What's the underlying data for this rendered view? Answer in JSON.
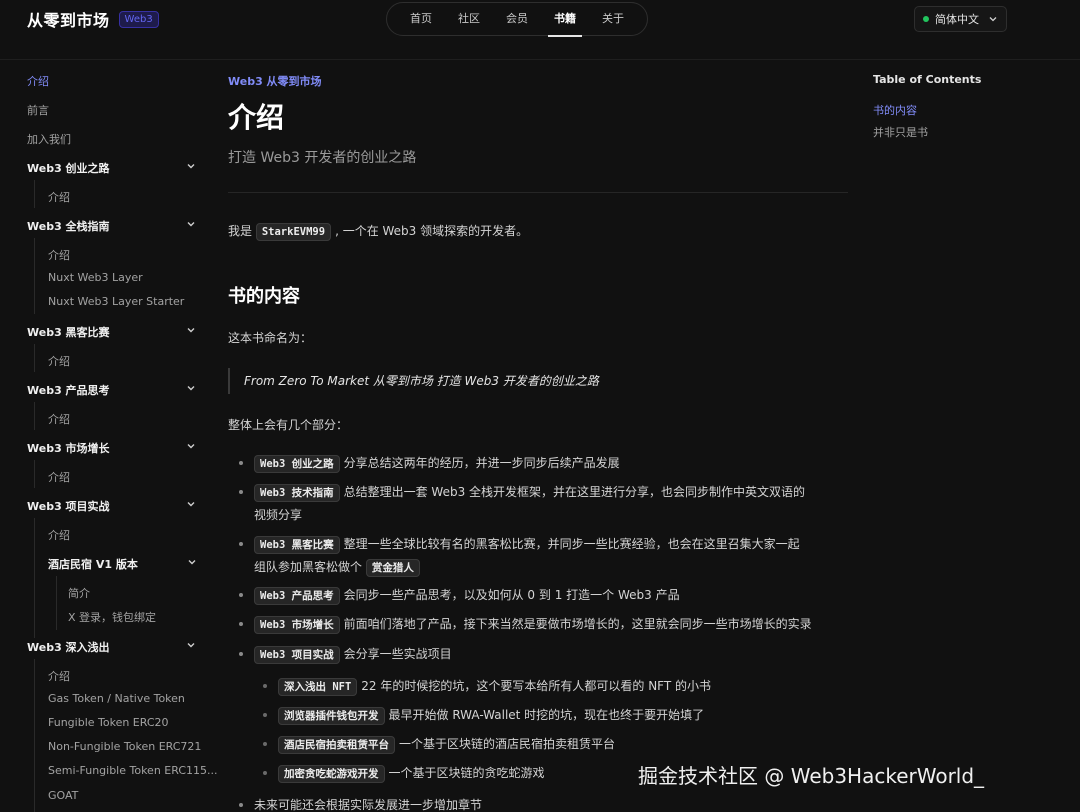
{
  "brand": {
    "title": "从零到市场",
    "badge": "Web3"
  },
  "nav": {
    "items": [
      "首页",
      "社区",
      "会员",
      "书籍",
      "关于"
    ],
    "active": "书籍"
  },
  "language": {
    "label": "简体中文",
    "status_color": "#22c55e"
  },
  "sidebar": {
    "top_items": [
      "介绍",
      "前言",
      "加入我们"
    ],
    "active_item": "介绍",
    "sections": [
      {
        "title": "Web3 创业之路",
        "items": [
          "介绍"
        ]
      },
      {
        "title": "Web3 全栈指南",
        "items": [
          "介绍",
          "Nuxt Web3 Layer",
          "Nuxt Web3 Layer Starter"
        ]
      },
      {
        "title": "Web3 黑客比赛",
        "items": [
          "介绍"
        ]
      },
      {
        "title": "Web3 产品思考",
        "items": [
          "介绍"
        ]
      },
      {
        "title": "Web3 市场增长",
        "items": [
          "介绍"
        ]
      },
      {
        "title": "Web3 项目实战",
        "items": [
          "介绍"
        ],
        "subsection": {
          "title": "酒店民宿 V1 版本",
          "items": [
            "简介",
            "X 登录，钱包绑定"
          ]
        }
      },
      {
        "title": "Web3 深入浅出",
        "items": [
          "介绍",
          "Gas Token / Native Token",
          "Fungible Token ERC20",
          "Non-Fungible Token ERC721",
          "Semi-Fungible Token ERC115...",
          "GOAT"
        ]
      }
    ]
  },
  "main": {
    "eyebrow": "Web3 从零到市场",
    "title": "介绍",
    "subtitle": "打造 Web3 开发者的创业之路",
    "intro": {
      "before": "我是",
      "code": "StarkEVM99",
      "after": ", 一个在 Web3 领域探索的开发者。"
    },
    "section_heading": "书的内容",
    "book_name_label": "这本书命名为：",
    "quote": "From Zero To Market 从零到市场 打造 Web3 开发者的创业之路",
    "parts_label": "整体上会有几个部分：",
    "list": [
      {
        "code": "Web3 创业之路",
        "text": "分享总结这两年的经历，并进一步同步后续产品发展"
      },
      {
        "code": "Web3 技术指南",
        "text": "总结整理出一套 Web3 全栈开发框架，并在这里进行分享，也会同步制作中英文双语的",
        "cont": "视频分享"
      },
      {
        "code": "Web3 黑客比赛",
        "text": "整理一些全球比较有名的黑客松比赛，并同步一些比赛经验，也会在这里召集大家一起",
        "cont": "组队参加黑客松做个",
        "cont_code": "赏金猎人"
      },
      {
        "code": "Web3 产品思考",
        "text": "会同步一些产品思考，以及如何从 0 到 1 打造一个 Web3 产品"
      },
      {
        "code": "Web3 市场增长",
        "text": "前面咱们落地了产品，接下来当然是要做市场增长的，这里就会同步一些市场增长的实录"
      },
      {
        "code": "Web3 项目实战",
        "text": "会分享一些实战项目"
      }
    ],
    "sublist": [
      {
        "code": "深入浅出 NFT",
        "text": "22 年的时候挖的坑，这个要写本给所有人都可以看的 NFT 的小书"
      },
      {
        "code": "浏览器插件钱包开发",
        "text": "最早开始做 RWA-Wallet 时挖的坑，现在也终于要开始填了"
      },
      {
        "code": "酒店民宿拍卖租赁平台",
        "text": "一个基于区块链的酒店民宿拍卖租赁平台"
      },
      {
        "code": "加密贪吃蛇游戏开发",
        "text": "一个基于区块链的贪吃蛇游戏"
      }
    ],
    "last_item": "未来可能还会根据实际发展进一步增加章节"
  },
  "toc": {
    "title": "Table of Contents",
    "items": [
      "书的内容",
      "并非只是书"
    ],
    "active": "书的内容"
  },
  "watermark": "掘金技术社区 @ Web3HackerWorld_",
  "colors": {
    "accent": "#818cf8",
    "background": "#111111"
  }
}
